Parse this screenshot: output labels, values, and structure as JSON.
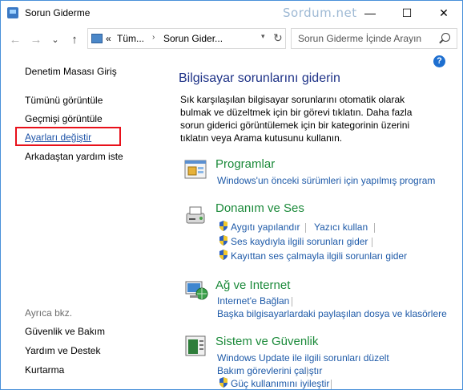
{
  "window": {
    "title": "Sorun Giderme",
    "watermark": "Sordum.net",
    "controls": {
      "minimize": "—",
      "maximize": "☐",
      "close": "✕"
    }
  },
  "navigation": {
    "back": "←",
    "forward": "→",
    "dropdown": "⌄",
    "up": "↑",
    "breadcrumb": [
      "Tüm...",
      "Sorun Gider..."
    ],
    "breadcrumb_prefix": "«",
    "refresh": "↻",
    "search_placeholder": "Sorun Giderme İçinde Arayın"
  },
  "help": "?",
  "sidebar": {
    "home": "Denetim Masası Giriş",
    "items": [
      "Tümünü görüntüle",
      "Geçmişi görüntüle",
      "Ayarları değiştir",
      "Arkadaştan yardım iste"
    ],
    "highlighted_index": 2,
    "highlight_color": "#e8101a",
    "see_also_label": "Ayrıca bkz.",
    "see_also": [
      "Güvenlik ve Bakım",
      "Yardım ve Destek",
      "Kurtarma"
    ]
  },
  "main": {
    "heading": "Bilgisayar sorunlarını giderin",
    "description": "Sık karşılaşılan bilgisayar sorunlarını otomatik olarak bulmak ve düzeltmek için bir görevi tıklatın. Daha fazla sorun giderici görüntülemek için bir kategorinin üzerini tıklatın veya Arama kutusunu kullanın.",
    "categories": [
      {
        "title": "Programlar",
        "icon": "programs-icon",
        "tasks": [
          "Windows'un önceki sürümleri için yapılmış program"
        ]
      },
      {
        "title": "Donanım ve Ses",
        "icon": "hardware-sound-icon",
        "tasks": [
          "Aygıtı yapılandır",
          "Yazıcı kullan",
          "Ses kaydıyla ilgili sorunları gider",
          "Kayıttan ses çalmayla ilgili sorunları gider"
        ]
      },
      {
        "title": "Ağ ve Internet",
        "icon": "network-icon",
        "tasks": [
          "Internet'e Bağlan",
          "Başka bilgisayarlardaki paylaşılan dosya ve klasörlere"
        ]
      },
      {
        "title": "Sistem ve Güvenlik",
        "icon": "system-security-icon",
        "tasks": [
          "Windows Update ile ilgili sorunları düzelt",
          "Bakım görevlerini çalıştır",
          "Güç kullanımını iyileştir"
        ]
      }
    ]
  },
  "colors": {
    "heading": "#1e3287",
    "category_title": "#1b8a3a",
    "task_link": "#1e5aa8",
    "accent": "#1e6fd0"
  }
}
